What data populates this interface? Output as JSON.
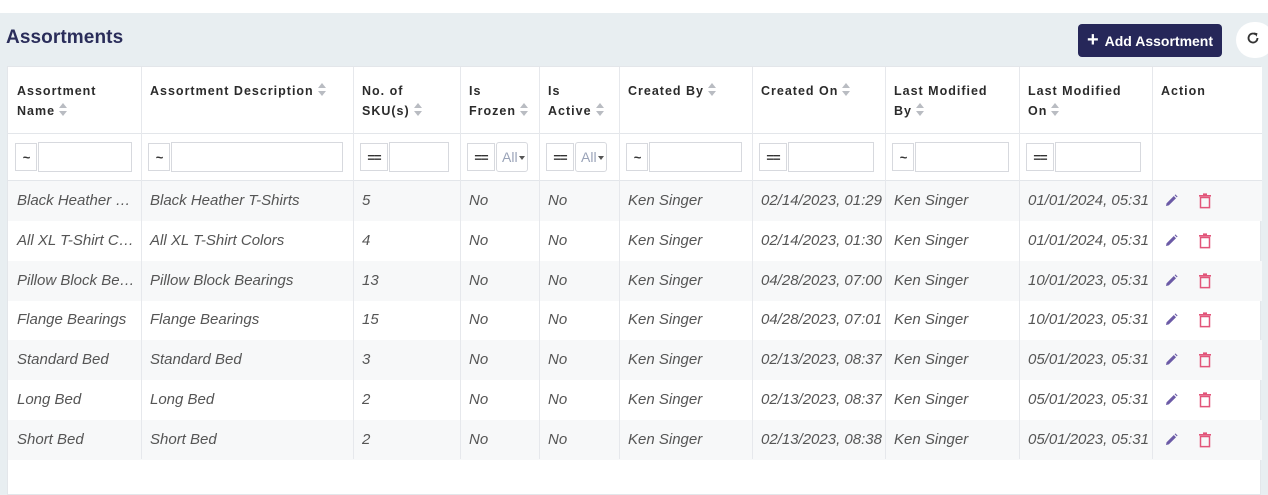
{
  "page": {
    "title": "Assortments",
    "add_button_label": "Add Assortment",
    "accent_color": "#262759",
    "delete_color": "#e2557a",
    "edit_color": "#6b5aa6"
  },
  "columns": [
    {
      "key": "name",
      "label_line1": "Assortment",
      "label_line2": "Name",
      "sortable": true,
      "filter_op": "~",
      "filter_type": "text"
    },
    {
      "key": "description",
      "label_line1": "Assortment Description",
      "label_line2": "",
      "sortable": true,
      "filter_op": "~",
      "filter_type": "text"
    },
    {
      "key": "skus",
      "label_line1": "No. of",
      "label_line2": "SKU(s)",
      "sortable": true,
      "filter_op": "==",
      "filter_type": "text"
    },
    {
      "key": "frozen",
      "label_line1": "Is",
      "label_line2": "Frozen",
      "sortable": true,
      "filter_op": "==",
      "filter_type": "select",
      "filter_value": "All"
    },
    {
      "key": "active",
      "label_line1": "Is",
      "label_line2": "Active",
      "sortable": true,
      "filter_op": "==",
      "filter_type": "select",
      "filter_value": "All"
    },
    {
      "key": "created_by",
      "label_line1": "Created By",
      "label_line2": "",
      "sortable": true,
      "filter_op": "~",
      "filter_type": "text"
    },
    {
      "key": "created_on",
      "label_line1": "Created On",
      "label_line2": "",
      "sortable": true,
      "filter_op": "==",
      "filter_type": "text"
    },
    {
      "key": "modified_by",
      "label_line1": "Last Modified",
      "label_line2": "By",
      "sortable": true,
      "filter_op": "~",
      "filter_type": "text"
    },
    {
      "key": "modified_on",
      "label_line1": "Last Modified",
      "label_line2": "On",
      "sortable": true,
      "filter_op": "==",
      "filter_type": "text"
    },
    {
      "key": "action",
      "label_line1": "Action",
      "label_line2": "",
      "sortable": false
    }
  ],
  "rows": [
    {
      "name": "Black Heather T-Shirts",
      "description": "Black Heather T-Shirts",
      "skus": "5",
      "frozen": "No",
      "active": "No",
      "created_by": "Ken Singer",
      "created_on": "02/14/2023, 01:29",
      "modified_by": "Ken Singer",
      "modified_on": "01/01/2024, 05:31"
    },
    {
      "name": "All XL T-Shirt Colors",
      "description": "All XL T-Shirt Colors",
      "skus": "4",
      "frozen": "No",
      "active": "No",
      "created_by": "Ken Singer",
      "created_on": "02/14/2023, 01:30",
      "modified_by": "Ken Singer",
      "modified_on": "01/01/2024, 05:31"
    },
    {
      "name": "Pillow Block Bearings",
      "description": "Pillow Block Bearings",
      "skus": "13",
      "frozen": "No",
      "active": "No",
      "created_by": "Ken Singer",
      "created_on": "04/28/2023, 07:00",
      "modified_by": "Ken Singer",
      "modified_on": "10/01/2023, 05:31"
    },
    {
      "name": "Flange Bearings",
      "description": "Flange Bearings",
      "skus": "15",
      "frozen": "No",
      "active": "No",
      "created_by": "Ken Singer",
      "created_on": "04/28/2023, 07:01",
      "modified_by": "Ken Singer",
      "modified_on": "10/01/2023, 05:31"
    },
    {
      "name": "Standard Bed",
      "description": "Standard Bed",
      "skus": "3",
      "frozen": "No",
      "active": "No",
      "created_by": "Ken Singer",
      "created_on": "02/13/2023, 08:37",
      "modified_by": "Ken Singer",
      "modified_on": "05/01/2023, 05:31"
    },
    {
      "name": "Long Bed",
      "description": "Long Bed",
      "skus": "2",
      "frozen": "No",
      "active": "No",
      "created_by": "Ken Singer",
      "created_on": "02/13/2023, 08:37",
      "modified_by": "Ken Singer",
      "modified_on": "05/01/2023, 05:31"
    },
    {
      "name": "Short Bed",
      "description": "Short Bed",
      "skus": "2",
      "frozen": "No",
      "active": "No",
      "created_by": "Ken Singer",
      "created_on": "02/13/2023, 08:38",
      "modified_by": "Ken Singer",
      "modified_on": "05/01/2023, 05:31"
    }
  ],
  "icons": {
    "add": "plus-icon",
    "refresh": "refresh-icon",
    "edit": "pencil-icon",
    "delete": "trash-icon",
    "sort": "sort-icon",
    "dropdown": "caret-down-icon"
  }
}
